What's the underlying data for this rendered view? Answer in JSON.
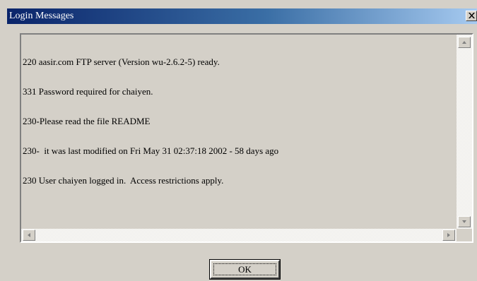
{
  "window": {
    "title": "Login Messages"
  },
  "messages": {
    "lines": [
      "220 aasir.com FTP server (Version wu-2.6.2-5) ready.",
      "331 Password required for chaiyen.",
      "230-Please read the file README",
      "230-  it was last modified on Fri May 31 02:37:18 2002 - 58 days ago",
      "230 User chaiyen logged in.  Access restrictions apply."
    ]
  },
  "buttons": {
    "ok_label": "OK"
  },
  "icons": {
    "close": "close-icon",
    "scroll_up": "arrow-up-icon",
    "scroll_down": "arrow-down-icon",
    "scroll_left": "arrow-left-icon",
    "scroll_right": "arrow-right-icon"
  },
  "colors": {
    "titlebar_start": "#0a246a",
    "titlebar_end": "#a6caf0",
    "face": "#d4d0c8"
  }
}
